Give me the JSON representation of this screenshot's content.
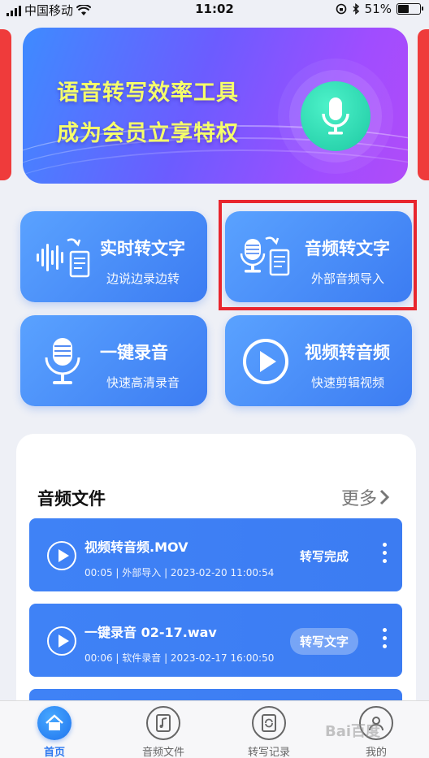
{
  "status_bar": {
    "carrier": "中国移动",
    "time": "11:02",
    "battery": "51%"
  },
  "banner": {
    "line1": "语音转写效率工具",
    "line2": "成为会员立享特权"
  },
  "features": [
    {
      "title": "实时转文字",
      "subtitle": "边说边录边转",
      "icon": "waveform-document-icon"
    },
    {
      "title": "音频转文字",
      "subtitle": "外部音频导入",
      "icon": "mic-document-icon"
    },
    {
      "title": "一键录音",
      "subtitle": "快速高清录音",
      "icon": "microphone-icon"
    },
    {
      "title": "视频转音频",
      "subtitle": "快速剪辑视频",
      "icon": "play-circle-icon"
    }
  ],
  "files_section": {
    "title": "音频文件",
    "more": "更多"
  },
  "files": [
    {
      "name": "视频转音频.MOV",
      "meta": "00:05 | 外部导入 | 2023-02-20 11:00:54",
      "status": "转写完成"
    },
    {
      "name": "一键录音 02-17.wav",
      "meta": "00:06 | 软件录音 | 2023-02-17 16:00:50",
      "status": "转写文字"
    }
  ],
  "tabs": [
    {
      "label": "首页",
      "icon": "home-icon",
      "active": true
    },
    {
      "label": "音频文件",
      "icon": "audio-file-icon"
    },
    {
      "label": "转写记录",
      "icon": "refresh-document-icon"
    },
    {
      "label": "我的",
      "icon": "user-icon"
    }
  ],
  "watermark": "Bai百度",
  "colors": {
    "card_blue": "#3c7cf2",
    "banner_text": "#f5ff6a",
    "highlight": "#e8262e",
    "accent_green": "#1ec9a3"
  }
}
